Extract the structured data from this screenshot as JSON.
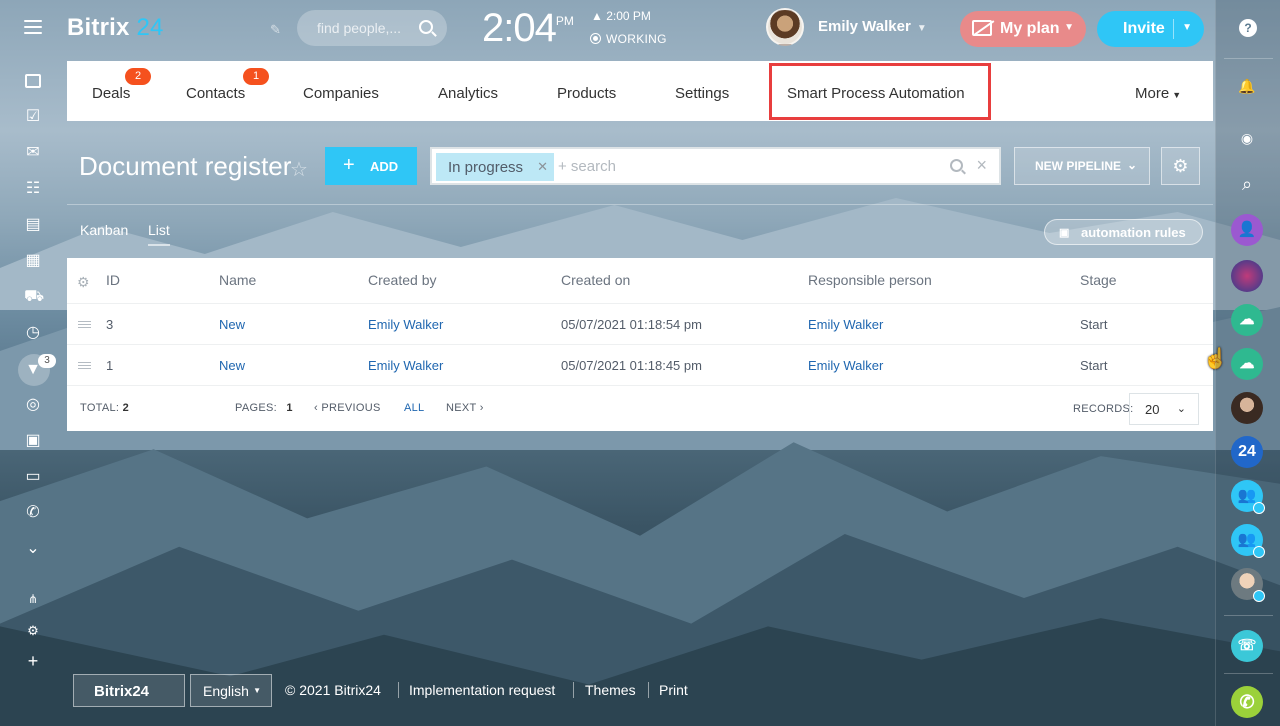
{
  "header": {
    "logo_main": "Bitrix",
    "logo_num": "24",
    "search_placeholder": "find people,...",
    "clock_time": "2:04",
    "clock_ampm": "PM",
    "alarm_time": "2:00 PM",
    "status": "WORKING",
    "user_name": "Emily Walker",
    "my_plan": "My plan",
    "invite": "Invite"
  },
  "left_sidebar": {
    "funnel_badge": "3"
  },
  "nav": {
    "items": [
      {
        "label": "Deals",
        "badge": "2"
      },
      {
        "label": "Contacts",
        "badge": "1"
      },
      {
        "label": "Companies"
      },
      {
        "label": "Analytics"
      },
      {
        "label": "Products"
      },
      {
        "label": "Settings"
      },
      {
        "label": "Smart Process Automation"
      }
    ],
    "more": "More"
  },
  "toolbar": {
    "title": "Document register",
    "add": "ADD",
    "filter_chip": "In progress",
    "search_placeholder": "+ search",
    "new_pipeline": "NEW PIPELINE"
  },
  "views": {
    "kanban": "Kanban",
    "list": "List",
    "automation_rules": "automation rules"
  },
  "table": {
    "columns": [
      "ID",
      "Name",
      "Created by",
      "Created on",
      "Responsible person",
      "Stage"
    ],
    "rows": [
      {
        "id": "3",
        "name": "New",
        "created_by": "Emily Walker",
        "created_on": "05/07/2021 01:18:54 pm",
        "responsible": "Emily Walker",
        "stage": "Start"
      },
      {
        "id": "1",
        "name": "New",
        "created_by": "Emily Walker",
        "created_on": "05/07/2021 01:18:45 pm",
        "responsible": "Emily Walker",
        "stage": "Start"
      }
    ],
    "footer": {
      "total_label": "TOTAL:",
      "total_value": "2",
      "pages_label": "PAGES:",
      "pages_value": "1",
      "previous": "PREVIOUS",
      "all": "ALL",
      "next": "NEXT",
      "records_label": "RECORDS:",
      "records_value": "20"
    }
  },
  "right_bar": {
    "counter_24": "24"
  },
  "page_footer": {
    "bitrix24": "Bitrix24",
    "language": "English",
    "copyright": "© 2021 Bitrix24",
    "implementation": "Implementation request",
    "themes": "Themes",
    "print": "Print"
  },
  "colors": {
    "accent": "#2fc6f6",
    "my_plan": "#e88a8a",
    "badge": "#f5511e",
    "highlight_box": "#e83e3e",
    "link": "#2067b0"
  }
}
